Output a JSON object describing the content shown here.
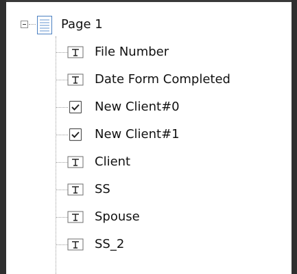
{
  "tree": {
    "root": {
      "label": "Page 1",
      "icon": "page-icon",
      "expanded": true
    },
    "items": [
      {
        "label": "File Number",
        "icon": "text-field-icon"
      },
      {
        "label": "Date Form Completed",
        "icon": "text-field-icon"
      },
      {
        "label": "New Client#0",
        "icon": "checkbox-icon"
      },
      {
        "label": "New Client#1",
        "icon": "checkbox-icon"
      },
      {
        "label": "Client",
        "icon": "text-field-icon"
      },
      {
        "label": "SS",
        "icon": "text-field-icon"
      },
      {
        "label": "Spouse",
        "icon": "text-field-icon"
      },
      {
        "label": "SS_2",
        "icon": "text-field-icon"
      }
    ]
  },
  "colors": {
    "border": "#2f2f2f",
    "connector": "#9a9a9a",
    "page_icon_blue": "#4a7fc1",
    "text": "#111111"
  }
}
